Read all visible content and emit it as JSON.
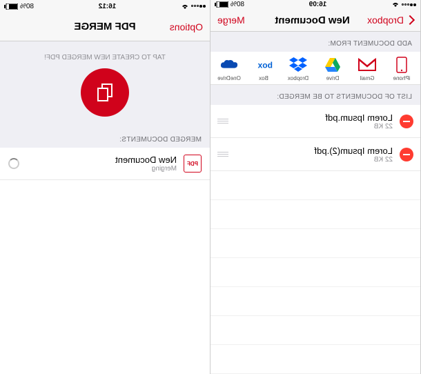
{
  "left": {
    "status": {
      "carrier": "••○○○",
      "time": "16:09",
      "battery": "80%"
    },
    "nav": {
      "back": "Dropbox",
      "title": "New Document",
      "right": "Merge"
    },
    "sections": {
      "add_from": "ADD DOCUMENT FROM:",
      "to_merge": "LIST OF DOCUMENTS TO BE MERGED:"
    },
    "sources": [
      {
        "name": "iPhone"
      },
      {
        "name": "Gmail"
      },
      {
        "name": "Drive"
      },
      {
        "name": "Dropbox"
      },
      {
        "name": "Box"
      },
      {
        "name": "OneDrive"
      }
    ],
    "docs": [
      {
        "name": "Lorem Ipsum.pdf",
        "size": "22 KB"
      },
      {
        "name": "Lorem Ipsum(2).pdf",
        "size": "22 KB"
      }
    ]
  },
  "right": {
    "status": {
      "carrier": "••○○○",
      "time": "16:12",
      "battery": "80%"
    },
    "nav": {
      "left": "Options",
      "title": "PDF MERGE",
      "right": ""
    },
    "hint": "TAP TO CREATE NEW MERGED PDF!",
    "section_merged": "MERGED DOCUMENTS:",
    "merged": {
      "name": "New Document",
      "status": "Merging",
      "badge": "PDF"
    }
  }
}
